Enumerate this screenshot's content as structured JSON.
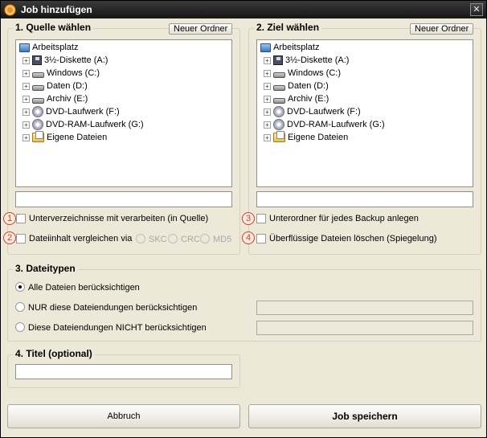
{
  "window": {
    "title": "Job hinzufügen",
    "close_glyph": "✕"
  },
  "source": {
    "legend": "1. Quelle wählen",
    "new_folder_label": "Neuer Ordner",
    "tree": [
      {
        "label": "Arbeitsplatz",
        "icon": "computer-icon"
      },
      {
        "label": "3½-Diskette (A:)",
        "icon": "floppy-icon"
      },
      {
        "label": "Windows (C:)",
        "icon": "drive-icon"
      },
      {
        "label": "Daten (D:)",
        "icon": "drive-icon"
      },
      {
        "label": "Archiv (E:)",
        "icon": "drive-icon"
      },
      {
        "label": "DVD-Laufwerk (F:)",
        "icon": "dvd-icon"
      },
      {
        "label": "DVD-RAM-Laufwerk (G:)",
        "icon": "dvd-icon"
      },
      {
        "label": "Eigene Dateien",
        "icon": "folder-icon"
      }
    ],
    "path_value": "",
    "opt_subdirs": "Unterverzeichnisse mit verarbeiten (in Quelle)",
    "opt_compare": "Dateiinhalt vergleichen via",
    "compare_methods": [
      "SKC",
      "CRC",
      "MD5"
    ]
  },
  "target": {
    "legend": "2. Ziel wählen",
    "new_folder_label": "Neuer Ordner",
    "tree": [
      {
        "label": "Arbeitsplatz",
        "icon": "computer-icon"
      },
      {
        "label": "3½-Diskette (A:)",
        "icon": "floppy-icon"
      },
      {
        "label": "Windows (C:)",
        "icon": "drive-icon"
      },
      {
        "label": "Daten (D:)",
        "icon": "drive-icon"
      },
      {
        "label": "Archiv (E:)",
        "icon": "drive-icon"
      },
      {
        "label": "DVD-Laufwerk (F:)",
        "icon": "dvd-icon"
      },
      {
        "label": "DVD-RAM-Laufwerk (G:)",
        "icon": "dvd-icon"
      },
      {
        "label": "Eigene Dateien",
        "icon": "folder-icon"
      }
    ],
    "path_value": "",
    "opt_subfolder": "Unterordner für jedes Backup anlegen",
    "opt_delete": "Überflüssige Dateien löschen (Spiegelung)"
  },
  "badges": [
    "1",
    "2",
    "3",
    "4"
  ],
  "filetypes": {
    "legend": "3. Dateitypen",
    "opt_all": "Alle Dateien berücksichtigen",
    "opt_only": "NUR diese Dateiendungen berücksichtigen",
    "opt_not": "Diese Dateiendungen NICHT berücksichtigen"
  },
  "title_section": {
    "legend": "4. Titel (optional)",
    "value": ""
  },
  "buttons": {
    "cancel": "Abbruch",
    "save": "Job speichern"
  },
  "colors": {
    "badge": "#d23a3a",
    "titlebar": "#1e1e1e"
  }
}
